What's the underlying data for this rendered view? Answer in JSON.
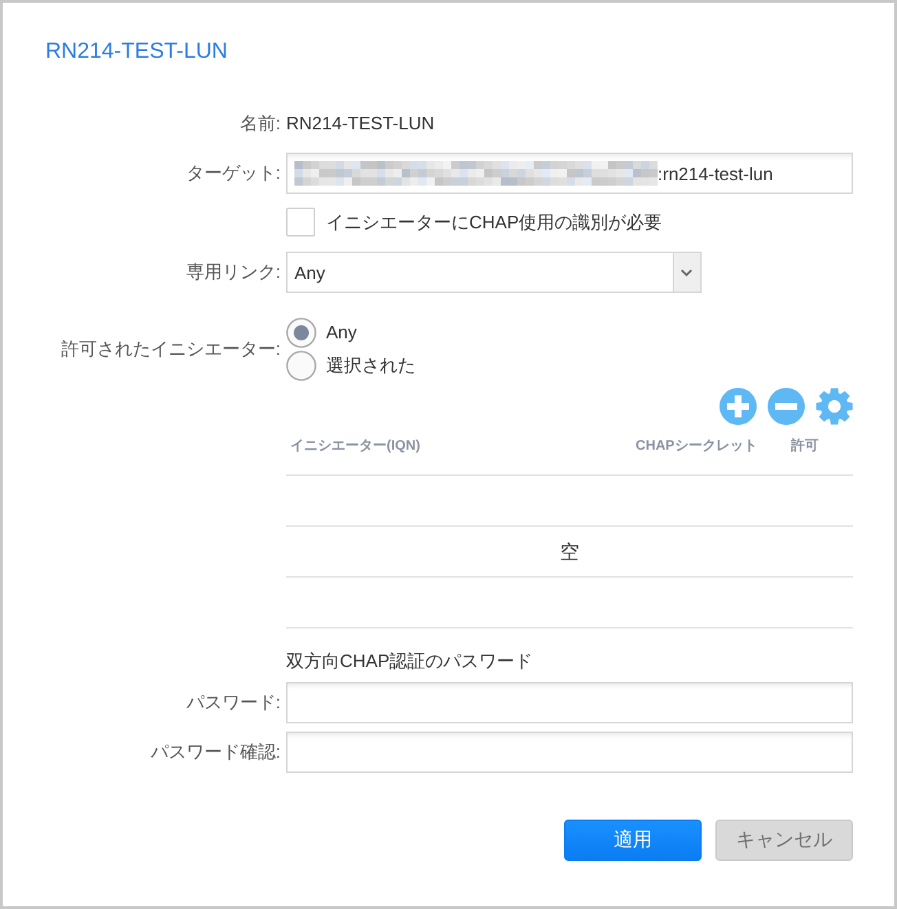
{
  "dialog": {
    "title": "RN214-TEST-LUN"
  },
  "fields": [
    {
      "kind": "static",
      "label": "名前:",
      "value": "RN214-TEST-LUN"
    },
    {
      "kind": "text",
      "label": "ターゲット:",
      "value": ":rn214-test-lun",
      "obscured": true
    },
    {
      "kind": "checkbox",
      "label": "イニシエーターにCHAP使用の識別が必要",
      "checked": false
    },
    {
      "kind": "select",
      "label": "専用リンク:",
      "value": "Any"
    },
    {
      "kind": "radio",
      "label": "許可されたイニシエーター:",
      "options": [
        {
          "label": "Any",
          "selected": true
        },
        {
          "label": "選択された",
          "selected": false
        }
      ]
    }
  ],
  "initiator_table": {
    "columns": [
      "イニシエーター(IQN)",
      "CHAPシークレット",
      "許可"
    ],
    "empty_text": "空"
  },
  "mutual_chap": {
    "title": "双方向CHAP認証のパスワード",
    "fields": [
      {
        "kind": "password",
        "label": "パスワード:"
      },
      {
        "kind": "password",
        "label": "パスワード確認:"
      }
    ]
  },
  "buttons": [
    {
      "label": "適用",
      "kind": "primary"
    },
    {
      "label": "キャンセル",
      "kind": "secondary"
    }
  ]
}
